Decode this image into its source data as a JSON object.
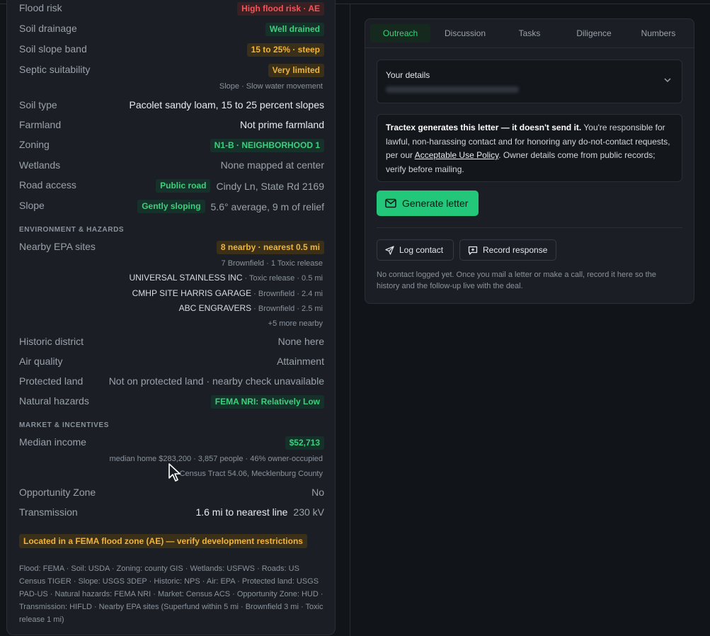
{
  "property": {
    "rows_top": [
      {
        "label": "Flood risk",
        "badge": "High flood risk · AE"
      },
      {
        "label": "Soil drainage",
        "badge": "Well drained"
      },
      {
        "label": "Soil slope band",
        "badge": "15 to 25% · steep"
      },
      {
        "label": "Septic suitability",
        "badge": "Very limited",
        "sub": "Slope · Slow water movement"
      },
      {
        "label": "Soil type",
        "value": "Pacolet sandy loam, 15 to 25 percent slopes"
      },
      {
        "label": "Farmland",
        "value": "Not prime farmland"
      },
      {
        "label": "Zoning",
        "badge": "N1-B · NEIGHBORHOOD 1"
      },
      {
        "label": "Wetlands",
        "value": "None mapped at center"
      },
      {
        "label": "Road access",
        "badge": "Public road",
        "value": "Cindy Ln, State Rd 2169"
      },
      {
        "label": "Slope",
        "badge": "Gently sloping",
        "value": "5.6° average, 9 m of relief"
      }
    ],
    "env_section": "ENVIRONMENT & HAZARDS",
    "epa": {
      "label": "Nearby EPA sites",
      "badge": "8 nearby · nearest 0.5 mi",
      "summary": "7 Brownfield · 1 Toxic release",
      "sites": [
        {
          "name": "UNIVERSAL STAINLESS INC",
          "detail": " · Toxic release · 0.5 mi"
        },
        {
          "name": "CMHP SITE HARRIS GARAGE",
          "detail": " · Brownfield · 2.4 mi"
        },
        {
          "name": "ABC ENGRAVERS",
          "detail": " · Brownfield · 2.5 mi"
        }
      ],
      "more": "+5 more nearby"
    },
    "rows_env": [
      {
        "label": "Historic district",
        "value": "None here"
      },
      {
        "label": "Air quality",
        "value": "Attainment"
      },
      {
        "label": "Protected land",
        "value": "Not on protected land · nearby check unavailable"
      },
      {
        "label": "Natural hazards",
        "badge": "FEMA NRI: Relatively Low"
      }
    ],
    "market_section": "MARKET & INCENTIVES",
    "income": {
      "label": "Median income",
      "badge": "$52,713",
      "sub1": "median home $283,200 · 3,857 people · 46% owner-occupied",
      "sub2": "Census Tract 54.06, Mecklenburg County"
    },
    "rows_market": [
      {
        "label": "Opportunity Zone",
        "value": "No"
      },
      {
        "label": "Transmission",
        "value_strong": "1.6 mi to nearest line",
        "value": "230 kV"
      }
    ],
    "warning": "Located in a FEMA flood zone (AE) — verify development restrictions",
    "sources": "Flood: FEMA · Soil: USDA · Zoning: county GIS · Wetlands: USFWS · Roads: US Census TIGER · Slope: USGS 3DEP · Historic: NPS · Air: EPA · Protected land: USGS PAD-US · Natural hazards: FEMA NRI · Market: Census ACS · Opportunity Zone: HUD · Transmission: HIFLD · Nearby EPA sites (Superfund within 5 mi · Brownfield 3 mi · Toxic release 1 mi)"
  },
  "outreach": {
    "tabs": [
      "Outreach",
      "Discussion",
      "Tasks",
      "Diligence",
      "Numbers"
    ],
    "active_tab": "Outreach",
    "details_title": "Your details",
    "notice_bold": "Tractex generates this letter — it doesn't send it.",
    "notice_text1": " You're responsible for lawful, non-harassing contact and for honoring any do-not-contact requests, per our ",
    "notice_link": "Acceptable Use Policy",
    "notice_text2": ". Owner details come from public records; verify before mailing.",
    "generate_label": "Generate letter",
    "log_label": "Log contact",
    "record_label": "Record response",
    "empty_note": "No contact logged yet. Once you mail a letter or make a call, record it here so the history and the follow-up live with the deal."
  },
  "colors": {
    "accent": "#22c77a",
    "danger": "#f2555a",
    "warning": "#f0b43a"
  }
}
